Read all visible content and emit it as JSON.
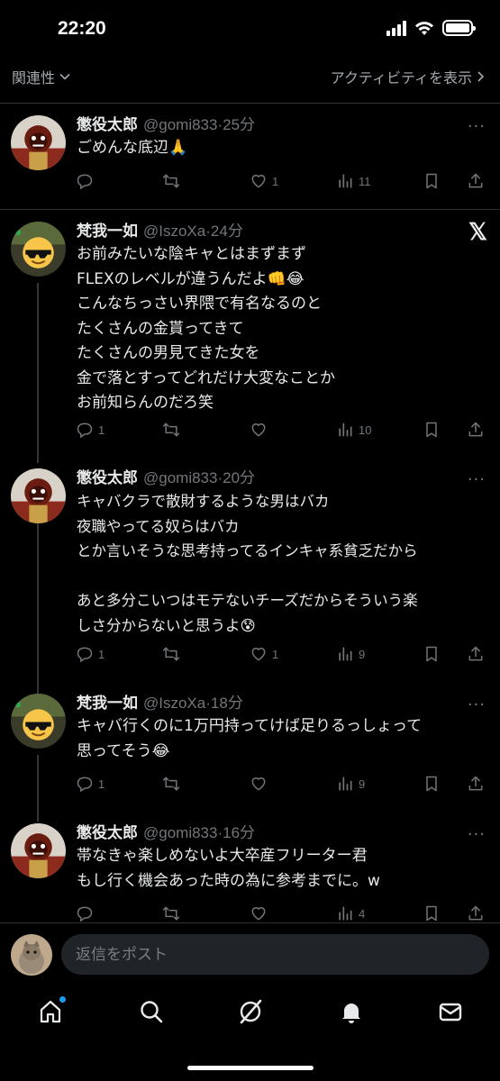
{
  "status_bar": {
    "time": "22:20"
  },
  "header": {
    "sort_label": "関連性",
    "activity_label": "アクティビティを表示"
  },
  "tweets": [
    {
      "name": "懲役太郎",
      "handle": "@gomi833",
      "time": "25分",
      "text": "ごめんな底辺🙏",
      "replies": "",
      "retweets": "",
      "likes": "1",
      "views": "11"
    },
    {
      "name": "梵我一如",
      "handle": "@IszoXa",
      "time": "24分",
      "text": "お前みたいな陰キャとはまずまず\nFLEXのレベルが違うんだよ👊😂\nこんなちっさい界隈で有名なるのと\nたくさんの金貰ってきて\nたくさんの男見てきた女を\n金で落とすってどれだけ大変なことか\nお前知らんのだろ笑",
      "replies": "1",
      "retweets": "",
      "likes": "",
      "views": "10"
    },
    {
      "name": "懲役太郎",
      "handle": "@gomi833",
      "time": "20分",
      "text": "キャバクラで散財するような男はバカ\n夜職やってる奴らはバカ\nとか言いそうな思考持ってるインキャ系貧乏だから\n\nあと多分こいつはモテないチーズだからそういう楽\nしさ分からないと思うよ😰",
      "replies": "1",
      "retweets": "",
      "likes": "1",
      "views": "9"
    },
    {
      "name": "梵我一如",
      "handle": "@IszoXa",
      "time": "18分",
      "text": "キャバ行くのに1万円持ってけば足りるっしょって\n思ってそう😂",
      "replies": "1",
      "retweets": "",
      "likes": "",
      "views": "9"
    },
    {
      "name": "懲役太郎",
      "handle": "@gomi833",
      "time": "16分",
      "text": "帯なきゃ楽しめないよ大卒産フリーター君\nもし行く機会あった時の為に参考までに。w",
      "replies": "",
      "retweets": "",
      "likes": "",
      "views": "4"
    }
  ],
  "composer": {
    "placeholder": "返信をポスト"
  },
  "nav": [
    "home-icon",
    "search-icon",
    "grok-icon",
    "notifications-icon",
    "messages-icon"
  ],
  "colors": {
    "background": "#000000",
    "text": "#e7e9ea",
    "muted": "#71767b",
    "accent": "#1d9bf0"
  }
}
